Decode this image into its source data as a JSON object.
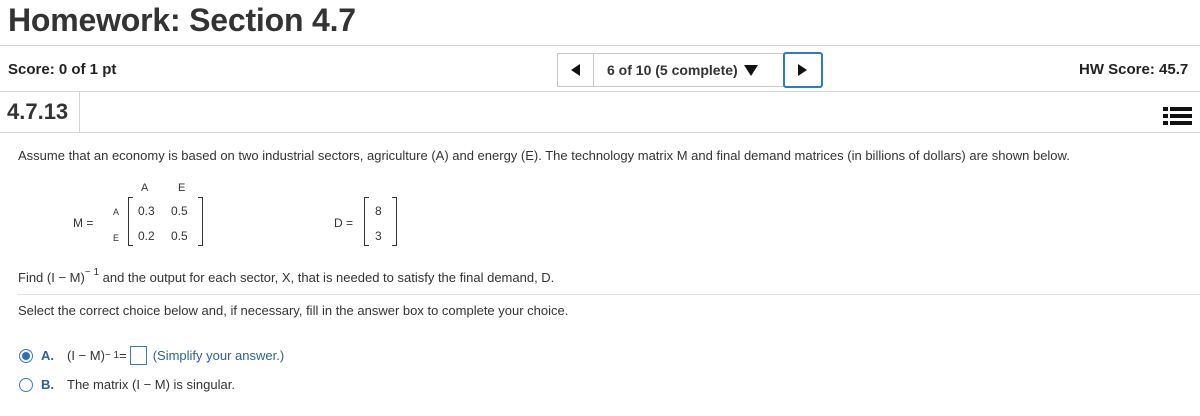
{
  "header": {
    "title": "Homework: Section 4.7"
  },
  "score_bar": {
    "score": "Score: 0 of 1 pt",
    "progress": "6 of 10 (5 complete)",
    "hw_score": "HW Score: 45.7"
  },
  "question": {
    "number": "4.7.13",
    "statement": "Assume that an economy is based on two industrial sectors, agriculture (A) and energy (E). The technology matrix M and final demand matrices (in billions of dollars) are shown below.",
    "matrix_M": {
      "label": "M =",
      "col_headers": [
        "A",
        "E"
      ],
      "row_headers": [
        "A",
        "E"
      ],
      "rows": [
        [
          "0.3",
          "0.5"
        ],
        [
          "0.2",
          "0.5"
        ]
      ]
    },
    "matrix_D": {
      "label": "D =",
      "values": [
        "8",
        "3"
      ]
    },
    "find_prefix": "Find (I − M)",
    "find_exponent": "− 1",
    "find_suffix": " and the output for each sector, X, that is needed to satisfy the final demand, D.",
    "select_instruction": "Select the correct choice below and, if necessary, fill in the answer box to complete your choice.",
    "choices": [
      {
        "letter": "A.",
        "expr": "(I − M)",
        "exponent": "− 1",
        "equals": " =",
        "hint": "(Simplify your answer.)",
        "selected": true
      },
      {
        "letter": "B.",
        "text": "The matrix (I − M) is singular.",
        "selected": false
      }
    ]
  }
}
